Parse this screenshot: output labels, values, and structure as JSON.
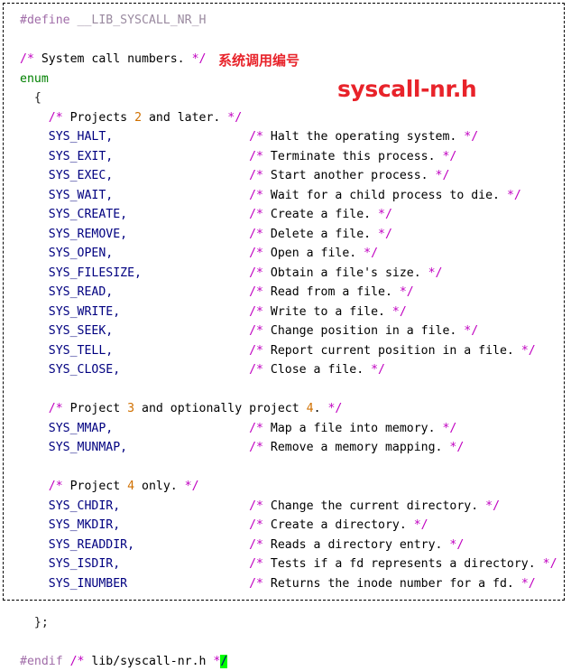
{
  "frame": {
    "border_style": "dashed",
    "border_color": "#000000",
    "background": "#ffffff"
  },
  "annotations": {
    "chinese_label": "系统调用编号",
    "file_title": "syscall-nr.h",
    "color": "#e8232a"
  },
  "colors": {
    "preprocessor": "#a06ca8",
    "macro_identifier": "#9a8aa0",
    "keyword": "#008000",
    "punctuation": "#202020",
    "identifier": "#000080",
    "comment_delimiter": "#c000c0",
    "comment_text": "#1414e0",
    "comment_number": "#d07000",
    "highlight_background": "#00ff00",
    "annotation_red": "#e8232a"
  },
  "code": {
    "language": "c",
    "lines": [
      {
        "indent": 0,
        "tokens": [
          {
            "t": "pre",
            "v": "#define"
          },
          {
            "t": "plain",
            "v": " "
          },
          {
            "t": "macroid",
            "v": "__LIB_SYSCALL_NR_H"
          }
        ]
      },
      {
        "indent": 0,
        "tokens": []
      },
      {
        "indent": 0,
        "tokens": [
          {
            "t": "cdelim",
            "v": "/*"
          },
          {
            "t": "ctext",
            "v": " System call numbers. "
          },
          {
            "t": "cdelim",
            "v": "*/"
          }
        ]
      },
      {
        "indent": 0,
        "tokens": [
          {
            "t": "kw",
            "v": "enum"
          }
        ]
      },
      {
        "indent": 2,
        "tokens": [
          {
            "t": "punc",
            "v": "{"
          }
        ]
      },
      {
        "indent": 4,
        "tokens": [
          {
            "t": "cdelim",
            "v": "/*"
          },
          {
            "t": "ctext",
            "v": " Projects "
          },
          {
            "t": "cnum",
            "v": "2"
          },
          {
            "t": "ctext",
            "v": " and later. "
          },
          {
            "t": "cdelim",
            "v": "*/"
          }
        ]
      },
      {
        "indent": 4,
        "tokens": [
          {
            "t": "ident",
            "v": "SYS_HALT,"
          },
          {
            "t": "gap",
            "v": "                   "
          },
          {
            "t": "cdelim",
            "v": "/*"
          },
          {
            "t": "ctext",
            "v": " Halt the operating system. "
          },
          {
            "t": "cdelim",
            "v": "*/"
          }
        ]
      },
      {
        "indent": 4,
        "tokens": [
          {
            "t": "ident",
            "v": "SYS_EXIT,"
          },
          {
            "t": "gap",
            "v": "                   "
          },
          {
            "t": "cdelim",
            "v": "/*"
          },
          {
            "t": "ctext",
            "v": " Terminate this process. "
          },
          {
            "t": "cdelim",
            "v": "*/"
          }
        ]
      },
      {
        "indent": 4,
        "tokens": [
          {
            "t": "ident",
            "v": "SYS_EXEC,"
          },
          {
            "t": "gap",
            "v": "                   "
          },
          {
            "t": "cdelim",
            "v": "/*"
          },
          {
            "t": "ctext",
            "v": " Start another process. "
          },
          {
            "t": "cdelim",
            "v": "*/"
          }
        ]
      },
      {
        "indent": 4,
        "tokens": [
          {
            "t": "ident",
            "v": "SYS_WAIT,"
          },
          {
            "t": "gap",
            "v": "                   "
          },
          {
            "t": "cdelim",
            "v": "/*"
          },
          {
            "t": "ctext",
            "v": " Wait for a child process to die. "
          },
          {
            "t": "cdelim",
            "v": "*/"
          }
        ]
      },
      {
        "indent": 4,
        "tokens": [
          {
            "t": "ident",
            "v": "SYS_CREATE,"
          },
          {
            "t": "gap",
            "v": "                 "
          },
          {
            "t": "cdelim",
            "v": "/*"
          },
          {
            "t": "ctext",
            "v": " Create a file. "
          },
          {
            "t": "cdelim",
            "v": "*/"
          }
        ]
      },
      {
        "indent": 4,
        "tokens": [
          {
            "t": "ident",
            "v": "SYS_REMOVE,"
          },
          {
            "t": "gap",
            "v": "                 "
          },
          {
            "t": "cdelim",
            "v": "/*"
          },
          {
            "t": "ctext",
            "v": " Delete a file. "
          },
          {
            "t": "cdelim",
            "v": "*/"
          }
        ]
      },
      {
        "indent": 4,
        "tokens": [
          {
            "t": "ident",
            "v": "SYS_OPEN,"
          },
          {
            "t": "gap",
            "v": "                   "
          },
          {
            "t": "cdelim",
            "v": "/*"
          },
          {
            "t": "ctext",
            "v": " Open a file. "
          },
          {
            "t": "cdelim",
            "v": "*/"
          }
        ]
      },
      {
        "indent": 4,
        "tokens": [
          {
            "t": "ident",
            "v": "SYS_FILESIZE,"
          },
          {
            "t": "gap",
            "v": "               "
          },
          {
            "t": "cdelim",
            "v": "/*"
          },
          {
            "t": "ctext",
            "v": " Obtain a file's size. "
          },
          {
            "t": "cdelim",
            "v": "*/"
          }
        ]
      },
      {
        "indent": 4,
        "tokens": [
          {
            "t": "ident",
            "v": "SYS_READ,"
          },
          {
            "t": "gap",
            "v": "                   "
          },
          {
            "t": "cdelim",
            "v": "/*"
          },
          {
            "t": "ctext",
            "v": " Read from a file. "
          },
          {
            "t": "cdelim",
            "v": "*/"
          }
        ]
      },
      {
        "indent": 4,
        "tokens": [
          {
            "t": "ident",
            "v": "SYS_WRITE,"
          },
          {
            "t": "gap",
            "v": "                  "
          },
          {
            "t": "cdelim",
            "v": "/*"
          },
          {
            "t": "ctext",
            "v": " Write to a file. "
          },
          {
            "t": "cdelim",
            "v": "*/"
          }
        ]
      },
      {
        "indent": 4,
        "tokens": [
          {
            "t": "ident",
            "v": "SYS_SEEK,"
          },
          {
            "t": "gap",
            "v": "                   "
          },
          {
            "t": "cdelim",
            "v": "/*"
          },
          {
            "t": "ctext",
            "v": " Change position in a file. "
          },
          {
            "t": "cdelim",
            "v": "*/"
          }
        ]
      },
      {
        "indent": 4,
        "tokens": [
          {
            "t": "ident",
            "v": "SYS_TELL,"
          },
          {
            "t": "gap",
            "v": "                   "
          },
          {
            "t": "cdelim",
            "v": "/*"
          },
          {
            "t": "ctext",
            "v": " Report current position in a file. "
          },
          {
            "t": "cdelim",
            "v": "*/"
          }
        ]
      },
      {
        "indent": 4,
        "tokens": [
          {
            "t": "ident",
            "v": "SYS_CLOSE,"
          },
          {
            "t": "gap",
            "v": "                  "
          },
          {
            "t": "cdelim",
            "v": "/*"
          },
          {
            "t": "ctext",
            "v": " Close a file. "
          },
          {
            "t": "cdelim",
            "v": "*/"
          }
        ]
      },
      {
        "indent": 0,
        "tokens": []
      },
      {
        "indent": 4,
        "tokens": [
          {
            "t": "cdelim",
            "v": "/*"
          },
          {
            "t": "ctext",
            "v": " Project "
          },
          {
            "t": "cnum",
            "v": "3"
          },
          {
            "t": "ctext",
            "v": " and optionally project "
          },
          {
            "t": "cnum",
            "v": "4"
          },
          {
            "t": "ctext",
            "v": ". "
          },
          {
            "t": "cdelim",
            "v": "*/"
          }
        ]
      },
      {
        "indent": 4,
        "tokens": [
          {
            "t": "ident",
            "v": "SYS_MMAP,"
          },
          {
            "t": "gap",
            "v": "                   "
          },
          {
            "t": "cdelim",
            "v": "/*"
          },
          {
            "t": "ctext",
            "v": " Map a file into memory. "
          },
          {
            "t": "cdelim",
            "v": "*/"
          }
        ]
      },
      {
        "indent": 4,
        "tokens": [
          {
            "t": "ident",
            "v": "SYS_MUNMAP,"
          },
          {
            "t": "gap",
            "v": "                 "
          },
          {
            "t": "cdelim",
            "v": "/*"
          },
          {
            "t": "ctext",
            "v": " Remove a memory mapping. "
          },
          {
            "t": "cdelim",
            "v": "*/"
          }
        ]
      },
      {
        "indent": 0,
        "tokens": []
      },
      {
        "indent": 4,
        "tokens": [
          {
            "t": "cdelim",
            "v": "/*"
          },
          {
            "t": "ctext",
            "v": " Project "
          },
          {
            "t": "cnum",
            "v": "4"
          },
          {
            "t": "ctext",
            "v": " only. "
          },
          {
            "t": "cdelim",
            "v": "*/"
          }
        ]
      },
      {
        "indent": 4,
        "tokens": [
          {
            "t": "ident",
            "v": "SYS_CHDIR,"
          },
          {
            "t": "gap",
            "v": "                  "
          },
          {
            "t": "cdelim",
            "v": "/*"
          },
          {
            "t": "ctext",
            "v": " Change the current directory. "
          },
          {
            "t": "cdelim",
            "v": "*/"
          }
        ]
      },
      {
        "indent": 4,
        "tokens": [
          {
            "t": "ident",
            "v": "SYS_MKDIR,"
          },
          {
            "t": "gap",
            "v": "                  "
          },
          {
            "t": "cdelim",
            "v": "/*"
          },
          {
            "t": "ctext",
            "v": " Create a directory. "
          },
          {
            "t": "cdelim",
            "v": "*/"
          }
        ]
      },
      {
        "indent": 4,
        "tokens": [
          {
            "t": "ident",
            "v": "SYS_READDIR,"
          },
          {
            "t": "gap",
            "v": "                "
          },
          {
            "t": "cdelim",
            "v": "/*"
          },
          {
            "t": "ctext",
            "v": " Reads a directory entry. "
          },
          {
            "t": "cdelim",
            "v": "*/"
          }
        ]
      },
      {
        "indent": 4,
        "tokens": [
          {
            "t": "ident",
            "v": "SYS_ISDIR,"
          },
          {
            "t": "gap",
            "v": "                  "
          },
          {
            "t": "cdelim",
            "v": "/*"
          },
          {
            "t": "ctext",
            "v": " Tests if a fd represents a directory. "
          },
          {
            "t": "cdelim",
            "v": "*/"
          }
        ]
      },
      {
        "indent": 4,
        "tokens": [
          {
            "t": "ident",
            "v": "SYS_INUMBER"
          },
          {
            "t": "gap",
            "v": "                 "
          },
          {
            "t": "cdelim",
            "v": "/*"
          },
          {
            "t": "ctext",
            "v": " Returns the inode number for a fd. "
          },
          {
            "t": "cdelim",
            "v": "*/"
          }
        ]
      },
      {
        "indent": 0,
        "tokens": []
      },
      {
        "indent": 2,
        "tokens": [
          {
            "t": "punc",
            "v": "};"
          }
        ]
      },
      {
        "indent": 0,
        "tokens": []
      },
      {
        "indent": 0,
        "tokens": [
          {
            "t": "pre",
            "v": "#endif"
          },
          {
            "t": "plain",
            "v": " "
          },
          {
            "t": "cdelim",
            "v": "/*"
          },
          {
            "t": "ctext",
            "v": " lib/syscall-nr.h "
          },
          {
            "t": "cdelim",
            "v": "*"
          },
          {
            "t": "hl",
            "v": "/"
          }
        ]
      }
    ]
  }
}
